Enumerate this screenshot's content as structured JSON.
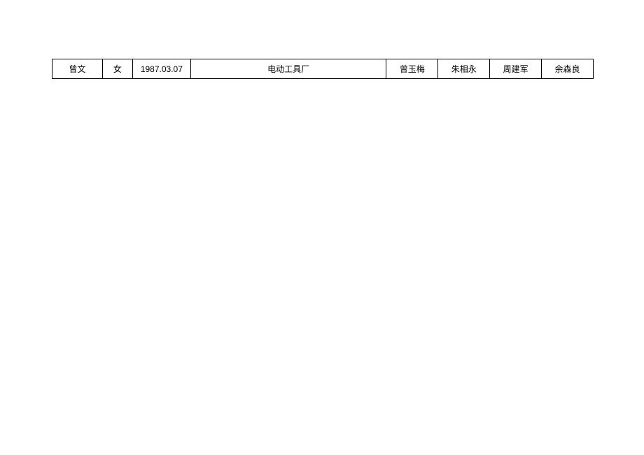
{
  "table": {
    "rows": [
      {
        "name": "曾文",
        "gender": "女",
        "date": "1987.03.07",
        "workplace": "电动工具厂",
        "person1": "曾玉梅",
        "person2": "朱相永",
        "person3": "周建军",
        "person4": "余森良"
      }
    ]
  }
}
